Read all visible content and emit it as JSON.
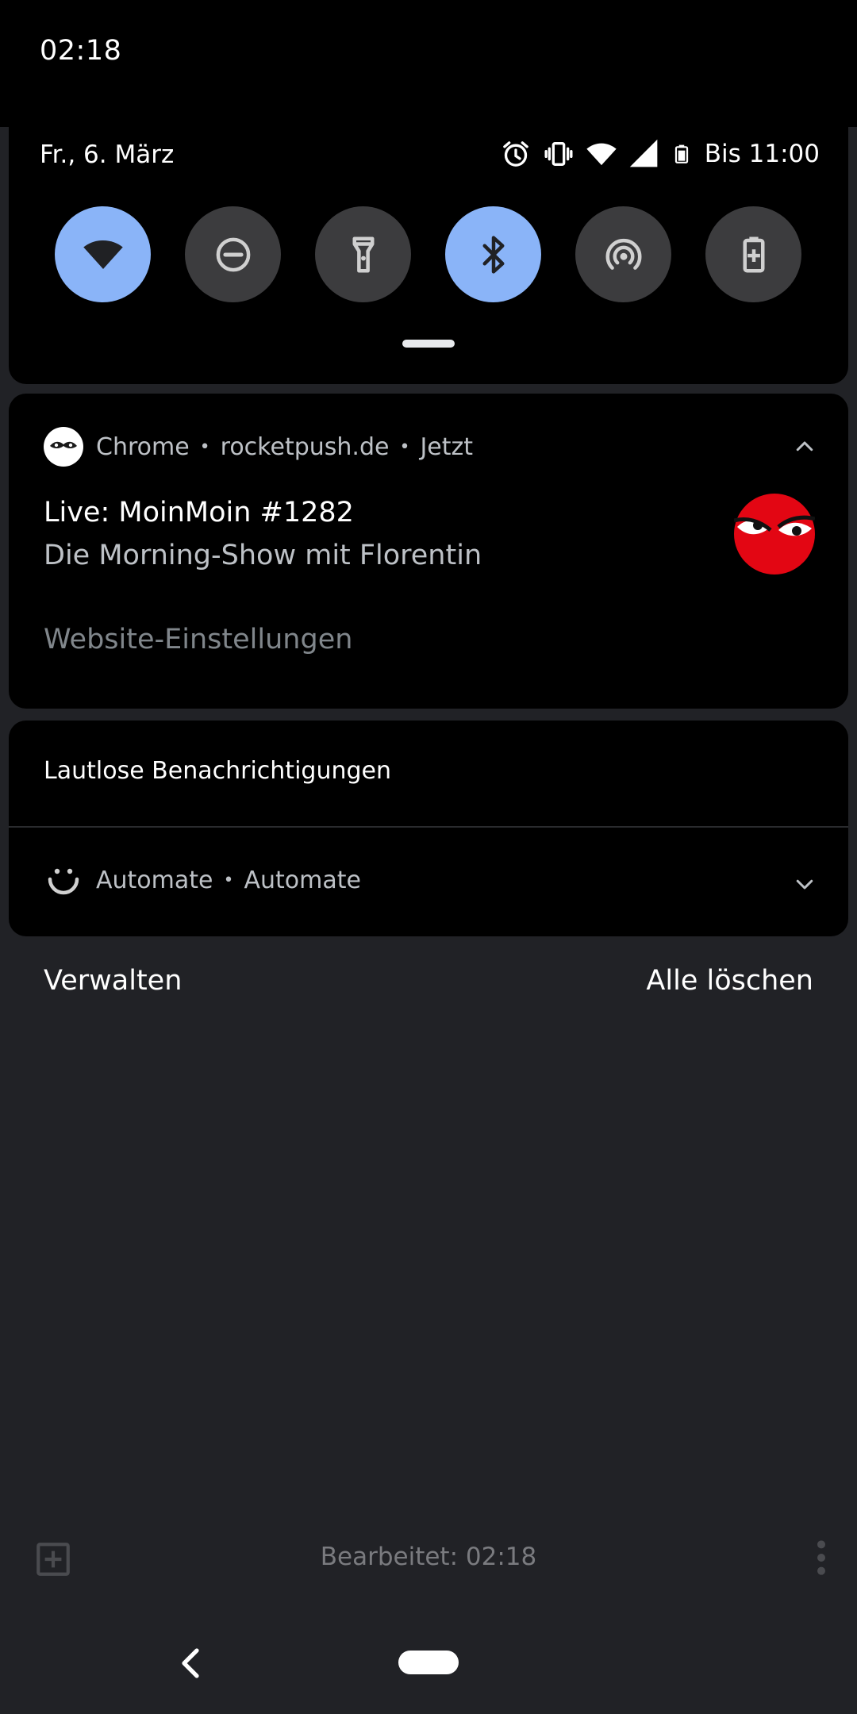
{
  "status_bar": {
    "time": "02:18"
  },
  "quick_settings": {
    "date": "Fr., 6. März",
    "battery_text": "Bis 11:00",
    "status_icons": [
      "alarm-icon",
      "vibrate-icon",
      "wifi-signal-icon",
      "cell-signal-icon",
      "battery-icon"
    ],
    "tiles": [
      {
        "name": "wifi",
        "icon": "wifi-icon",
        "state": "on"
      },
      {
        "name": "do-not-disturb",
        "icon": "do-not-disturb-icon",
        "state": "off"
      },
      {
        "name": "flashlight",
        "icon": "flashlight-icon",
        "state": "off"
      },
      {
        "name": "bluetooth",
        "icon": "bluetooth-icon",
        "state": "on"
      },
      {
        "name": "hotspot",
        "icon": "hotspot-icon",
        "state": "off"
      },
      {
        "name": "battery-saver",
        "icon": "battery-saver-icon",
        "state": "off"
      }
    ],
    "accent_on": "#8ab4f8",
    "tile_off": "#3c3c3e"
  },
  "notifications": {
    "chrome": {
      "app": "Chrome",
      "source": "rocketpush.de",
      "time": "Jetzt",
      "title": "Live: MoinMoin #1282",
      "text": "Die Morning-Show mit Florentin",
      "action": "Website-Einstellungen",
      "thumb_color": "#e30613"
    },
    "silent": {
      "header": "Lautlose Benachrichtigungen",
      "automate": {
        "app": "Automate",
        "subtext": "Automate"
      }
    }
  },
  "footer": {
    "manage": "Verwalten",
    "clear_all": "Alle löschen"
  },
  "edit_bar": {
    "edited": "Bearbeitet: 02:18"
  }
}
